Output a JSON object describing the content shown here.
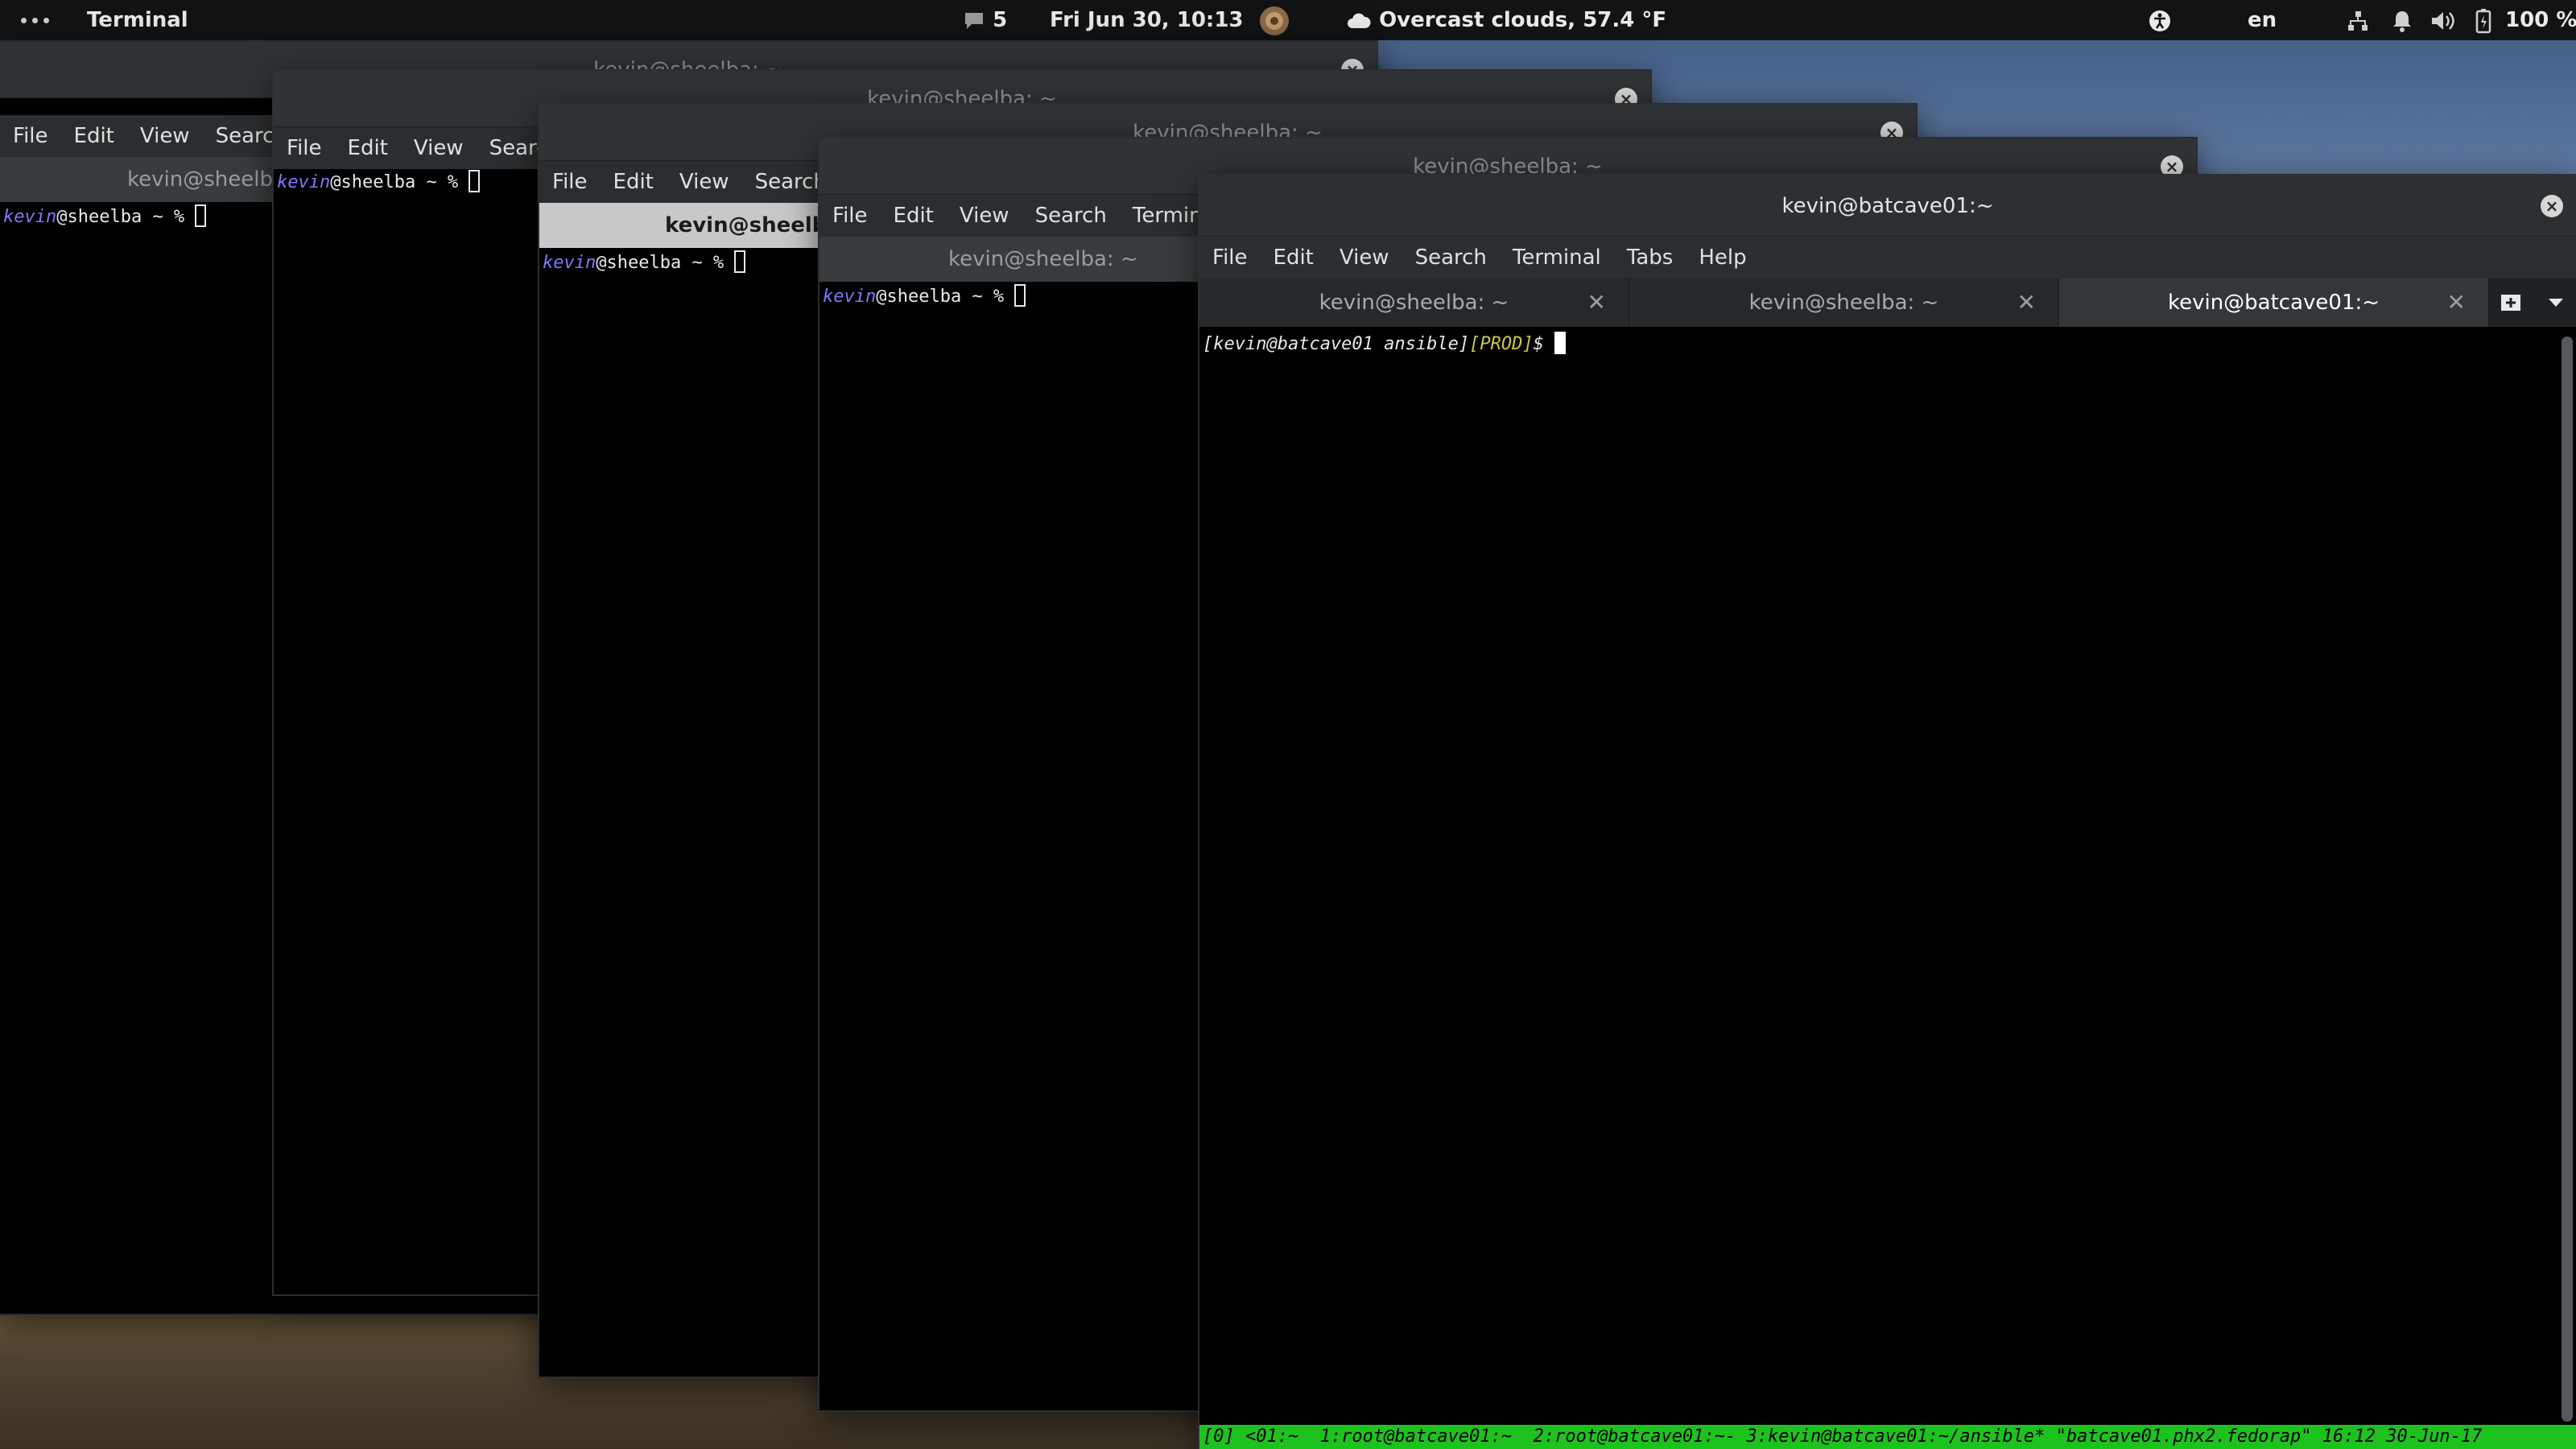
{
  "topbar": {
    "app_name": "Terminal",
    "notification_count": "5",
    "datetime": "Fri Jun 30, 10:13",
    "weather": "Overcast clouds, 57.4 °F",
    "language": "en",
    "battery": "100 %"
  },
  "menu": {
    "file": "File",
    "edit": "Edit",
    "view": "View",
    "search": "Search",
    "terminal": "Terminal",
    "tabs": "Tabs",
    "help": "Help"
  },
  "win1": {
    "title": "kevin@sheelba: ~",
    "tab_title": "kevin@sheelba: ~"
  },
  "win2": {
    "title": "kevin@sheelba: ~"
  },
  "win3": {
    "title": "kevin@sheelba: ~",
    "tab_title": "kevin@sheelba: ~"
  },
  "win4": {
    "title": "kevin@sheelba: ~",
    "tab_title": "kevin@sheelba: ~"
  },
  "shell": {
    "user": "kevin",
    "host_prompt": "@sheelba ~ % "
  },
  "main": {
    "title": "kevin@batcave01:~",
    "tabs": [
      {
        "label": "kevin@sheelba: ~"
      },
      {
        "label": "kevin@sheelba: ~"
      },
      {
        "label": "kevin@batcave01:~"
      }
    ],
    "prompt_user": "[kevin@batcave01 ansible]",
    "prompt_env": "[PROD]",
    "prompt_symbol": "$ ",
    "status_line": "[0] <01:~  1:root@batcave01:~  2:root@batcave01:~- 3:kevin@batcave01:~/ansible* \"batcave01.phx2.fedorap\" 16:12 30-Jun-17"
  },
  "colors": {
    "prompt_user": "#7a79ff",
    "prompt_env": "#c8c84a",
    "status_bg": "#1ec21e"
  }
}
